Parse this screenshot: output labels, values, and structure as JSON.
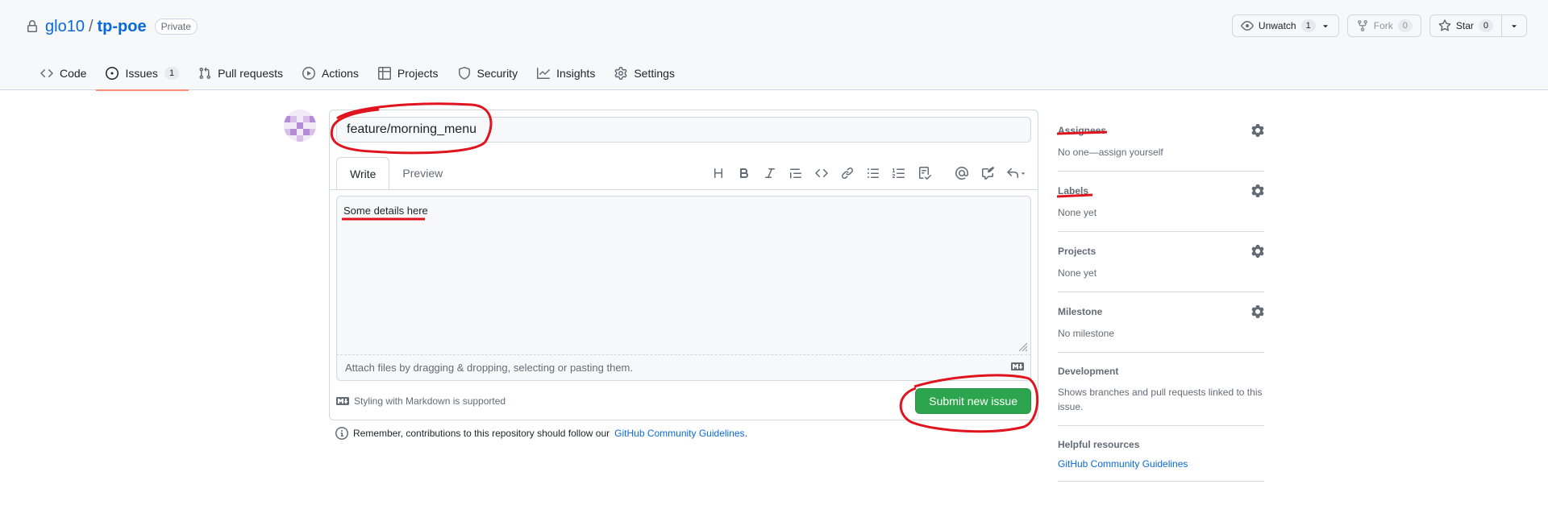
{
  "repo": {
    "owner": "glo10",
    "name": "tp-poe",
    "visibility": "Private",
    "unwatch_label": "Unwatch",
    "watch_count": "1",
    "fork_label": "Fork",
    "fork_count": "0",
    "star_label": "Star",
    "star_count": "0"
  },
  "tabs": [
    {
      "label": "Code",
      "icon": "code-icon"
    },
    {
      "label": "Issues",
      "icon": "issue-opened-icon",
      "count": "1",
      "selected": true
    },
    {
      "label": "Pull requests",
      "icon": "git-pull-request-icon"
    },
    {
      "label": "Actions",
      "icon": "play-icon"
    },
    {
      "label": "Projects",
      "icon": "table-icon"
    },
    {
      "label": "Security",
      "icon": "shield-icon"
    },
    {
      "label": "Insights",
      "icon": "graph-icon"
    },
    {
      "label": "Settings",
      "icon": "gear-icon"
    }
  ],
  "form": {
    "title_value": "feature/morning_menu",
    "write_tab": "Write",
    "preview_tab": "Preview",
    "body_text": "Some details here",
    "attach_text": "Attach files by dragging & dropping, selecting or pasting them.",
    "markdown_note": "Styling with Markdown is supported",
    "submit_label": "Submit new issue"
  },
  "reminder": {
    "text": "Remember, contributions to this repository should follow our",
    "link": "GitHub Community Guidelines",
    "suffix": "."
  },
  "sidebar": {
    "assignees_title": "Assignees",
    "assignees_value": "No one—assign yourself",
    "labels_title": "Labels",
    "labels_value": "None yet",
    "projects_title": "Projects",
    "projects_value": "None yet",
    "milestone_title": "Milestone",
    "milestone_value": "No milestone",
    "development_title": "Development",
    "development_value": "Shows branches and pull requests linked to this issue.",
    "helpful_title": "Helpful resources",
    "helpful_link": "GitHub Community Guidelines"
  },
  "colors": {
    "accent_link": "#0969da",
    "submit_green": "#2da44e",
    "tab_underline": "#fd8c73",
    "annotation_red": "#e0141e"
  }
}
